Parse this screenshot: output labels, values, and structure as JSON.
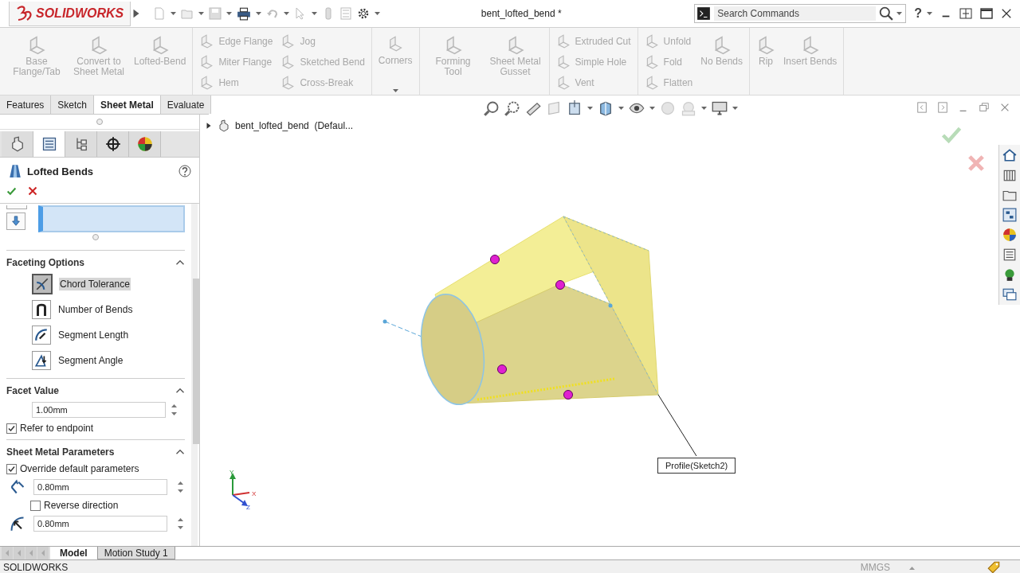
{
  "app": {
    "logo": "SOLIDWORKS",
    "title": "bent_lofted_bend *",
    "search": {
      "placeholder": "Search Commands"
    },
    "help": "?"
  },
  "ribbon": {
    "groups": [
      {
        "items": [
          {
            "kind": "large",
            "label": "Base Flange/Tab",
            "disabled": true
          },
          {
            "kind": "large",
            "label": "Convert to Sheet Metal",
            "disabled": true
          },
          {
            "kind": "large",
            "label": "Lofted-Bend",
            "disabled": true
          }
        ]
      },
      {
        "items": [
          {
            "kind": "small",
            "label": "Edge Flange",
            "disabled": true
          },
          {
            "kind": "small",
            "label": "Miter Flange",
            "disabled": true
          },
          {
            "kind": "small",
            "label": "Hem",
            "disabled": true
          },
          {
            "kind": "small",
            "label": "Jog",
            "disabled": true
          },
          {
            "kind": "small",
            "label": "Sketched Bend",
            "disabled": true
          },
          {
            "kind": "small",
            "label": "Cross-Break",
            "disabled": true
          }
        ]
      },
      {
        "items": [
          {
            "kind": "dropdown",
            "label": "Corners",
            "disabled": true
          }
        ]
      },
      {
        "items": [
          {
            "kind": "large",
            "label": "Forming Tool",
            "disabled": true
          },
          {
            "kind": "large",
            "label": "Sheet Metal Gusset",
            "disabled": true
          }
        ]
      },
      {
        "items": [
          {
            "kind": "small",
            "label": "Extruded Cut",
            "disabled": true
          },
          {
            "kind": "small",
            "label": "Simple Hole",
            "disabled": true
          },
          {
            "kind": "small",
            "label": "Vent",
            "disabled": true
          }
        ]
      },
      {
        "items": [
          {
            "kind": "small",
            "label": "Unfold",
            "disabled": true
          },
          {
            "kind": "small",
            "label": "Fold",
            "disabled": true
          },
          {
            "kind": "small",
            "label": "Flatten",
            "disabled": true
          },
          {
            "kind": "large",
            "label": "No Bends",
            "disabled": true
          }
        ]
      },
      {
        "items": [
          {
            "kind": "large",
            "label": "Rip",
            "disabled": true
          },
          {
            "kind": "large",
            "label": "Insert Bends",
            "disabled": true
          }
        ]
      }
    ]
  },
  "command_tabs": [
    {
      "label": "Features",
      "selected": false
    },
    {
      "label": "Sketch",
      "selected": false
    },
    {
      "label": "Sheet Metal",
      "selected": true
    },
    {
      "label": "Evaluate",
      "selected": false
    }
  ],
  "panel_tabs": [
    {
      "kind": "tree",
      "selected": false
    },
    {
      "kind": "property",
      "selected": true
    },
    {
      "kind": "configuration",
      "selected": false
    },
    {
      "kind": "target",
      "selected": false
    },
    {
      "kind": "appearance",
      "selected": false
    }
  ],
  "property_manager": {
    "title": "Lofted Bends",
    "faceting": {
      "title": "Faceting Options",
      "options": [
        {
          "label": "Chord Tolerance",
          "selected": true
        },
        {
          "label": "Number of Bends",
          "selected": false
        },
        {
          "label": "Segment Length",
          "selected": false
        },
        {
          "label": "Segment Angle",
          "selected": false
        }
      ]
    },
    "facet_value": {
      "title": "Facet Value",
      "value": "1.00mm",
      "refer_to_endpoint": {
        "label": "Refer to endpoint",
        "checked": true
      }
    },
    "parameters": {
      "title": "Sheet Metal Parameters",
      "override": {
        "label": "Override default parameters",
        "checked": true
      },
      "thickness": "0.80mm",
      "reverse": {
        "label": "Reverse direction",
        "checked": false
      },
      "bend_radius": "0.80mm"
    }
  },
  "graphics": {
    "tree_flyout": "bent_lofted_bend  (Defaul...",
    "callout": "Profile(Sketch2)",
    "triad": {
      "x": "X",
      "y": "Y",
      "z": "Z"
    }
  },
  "bottom_tabs": [
    {
      "label": "Model",
      "selected": true
    },
    {
      "label": "Motion Study 1",
      "selected": false
    }
  ],
  "status_bar": {
    "app": "SOLIDWORKS",
    "units": "MMGS"
  }
}
